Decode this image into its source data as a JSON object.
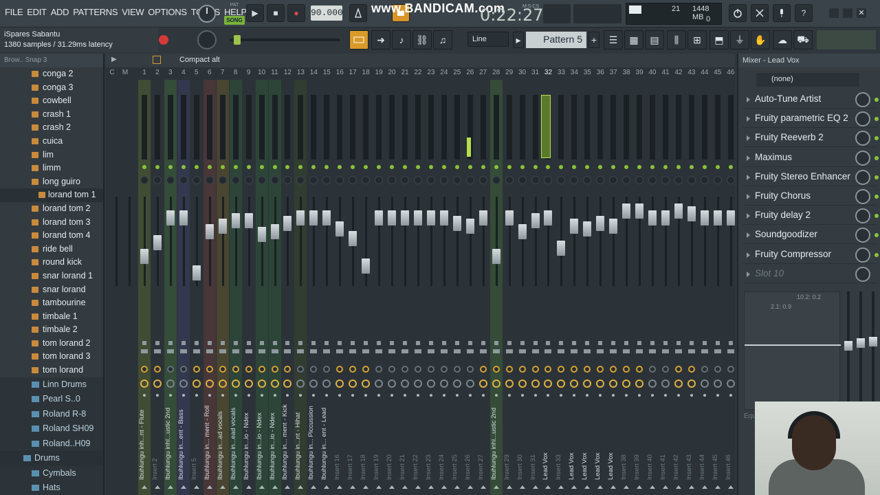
{
  "menu": [
    "FILE",
    "EDIT",
    "ADD",
    "PATTERNS",
    "VIEW",
    "OPTIONS",
    "TOOLS",
    "HELP"
  ],
  "transport": {
    "mode_small": "PAT",
    "mode": "SONG",
    "play": "▶",
    "stop": "■",
    "record": "●",
    "tempo": "90.000"
  },
  "watermark": "www.BANDICAM.com",
  "clock": {
    "time": "0:22:27",
    "label": "M:S:CS"
  },
  "cpu": {
    "v1": "21",
    "memory": "1448 MB",
    "v2": "0"
  },
  "hint": {
    "line1": "iSpares Sabantu",
    "line2": "1380 samples / 31.29ms latency"
  },
  "toolbar2": {
    "snap_mode": "Line",
    "pattern": "Pattern 5"
  },
  "browser": {
    "header": "Brow.. Snap 3",
    "items": [
      "conga 2",
      "conga 3",
      "cowbell",
      "crash 1",
      "crash 2",
      "cuica",
      "lim",
      "limm",
      "long guiro",
      "lorand tom 1",
      "lorand tom 2",
      "lorand tom 3",
      "lorand tom 4",
      "ride bell",
      "round kick",
      "snar lorand 1",
      "snar lorand",
      "tambourine",
      "timbale 1",
      "timbale 2",
      "tom lorand 2",
      "tom lorand 3",
      "tom lorand"
    ],
    "selected": "lorand tom 1",
    "folders": [
      "Linn Drums",
      "Pearl S..0 Kicks",
      "Roland R-8",
      "Roland SH09",
      "Roland..H09 (1)"
    ],
    "top_folder": "Drums",
    "sub_folders": [
      "Cymbals",
      "Hats"
    ]
  },
  "mixer": {
    "view": "Compact alt",
    "master_label": "C",
    "m_label": "M",
    "tracks": [
      {
        "n": "1",
        "name": "Ibuhlungu inh...nt - Flute",
        "color": "#5a6a32",
        "fader": 0.62,
        "ring": true
      },
      {
        "n": "2",
        "name": "Insert 2",
        "color": "",
        "fader": 0.72,
        "ring": true
      },
      {
        "n": "3",
        "name": "Ibuhlungu inhl...ustic 2nd",
        "color": "#3e6a3a",
        "fader": 0.9,
        "ring": false
      },
      {
        "n": "4",
        "name": "Ibuhlungu in...ent - Bass",
        "color": "#3c3e6a",
        "fader": 0.9,
        "ring": false
      },
      {
        "n": "5",
        "name": "Insert 5",
        "color": "",
        "fader": 0.5,
        "ring": true
      },
      {
        "n": "6",
        "name": "Ibuhlungu in... ment - Roll",
        "color": "#6a3a3a",
        "fader": 0.8,
        "ring": true
      },
      {
        "n": "7",
        "name": "Ibuhlungu in...ad vocals",
        "color": "#6a5a2a",
        "fader": 0.84,
        "ring": true
      },
      {
        "n": "8",
        "name": "Ibuhlungu in...ead vocals",
        "color": "#2f5a3a",
        "fader": 0.88,
        "ring": true
      },
      {
        "n": "9",
        "name": "Ibuhlungu in...io - Ndex",
        "color": "",
        "fader": 0.88,
        "ring": true
      },
      {
        "n": "10",
        "name": "Ibuhlungu in...io - Ndex",
        "color": "#2f5a3a",
        "fader": 0.78,
        "ring": true
      },
      {
        "n": "11",
        "name": "Ibuhlungu in...io - Ndex",
        "color": "#2f5a3a",
        "fader": 0.8,
        "ring": true
      },
      {
        "n": "12",
        "name": "Ibuhlungu in... ment - Kick",
        "color": "",
        "fader": 0.86,
        "ring": true
      },
      {
        "n": "13",
        "name": "Ibuhlungu in...nt - Hihat",
        "color": "#3a4a2a",
        "fader": 0.9,
        "ring": false
      },
      {
        "n": "14",
        "name": "Ibuhlungu in... Piccussion",
        "color": "",
        "fader": 0.9,
        "ring": false
      },
      {
        "n": "15",
        "name": "Ibuhlungu in... ent - Lead",
        "color": "",
        "fader": 0.9,
        "ring": false
      },
      {
        "n": "16",
        "name": "Insert 16",
        "color": "",
        "fader": 0.82,
        "ring": true
      },
      {
        "n": "17",
        "name": "Insert 17",
        "color": "",
        "fader": 0.75,
        "ring": true
      },
      {
        "n": "18",
        "name": "Insert 18",
        "color": "",
        "fader": 0.55,
        "ring": true
      },
      {
        "n": "19",
        "name": "Insert 19",
        "color": "",
        "fader": 0.9,
        "ring": false
      },
      {
        "n": "20",
        "name": "Insert 20",
        "color": "",
        "fader": 0.9,
        "ring": false
      },
      {
        "n": "21",
        "name": "Insert 21",
        "color": "",
        "fader": 0.9,
        "ring": false
      },
      {
        "n": "22",
        "name": "Insert 22",
        "color": "",
        "fader": 0.9,
        "ring": false
      },
      {
        "n": "23",
        "name": "Insert 23",
        "color": "",
        "fader": 0.9,
        "ring": false
      },
      {
        "n": "24",
        "name": "Insert 24",
        "color": "",
        "fader": 0.9,
        "ring": false
      },
      {
        "n": "25",
        "name": "Insert 25",
        "color": "",
        "fader": 0.86,
        "ring": false
      },
      {
        "n": "26",
        "name": "Insert 26",
        "color": "",
        "fader": 0.84,
        "ring": false
      },
      {
        "n": "27",
        "name": "Insert 27",
        "color": "",
        "fader": 0.9,
        "ring": true
      },
      {
        "n": "28",
        "name": "Ibuhlungu inhl...ustic 2nd",
        "color": "#3e6a3a",
        "fader": 0.62,
        "ring": true
      },
      {
        "n": "29",
        "name": "Insert 29",
        "color": "",
        "fader": 0.9,
        "ring": true
      },
      {
        "n": "30",
        "name": "Insert 30",
        "color": "",
        "fader": 0.8,
        "ring": true
      },
      {
        "n": "31",
        "name": "Insert 31",
        "color": "",
        "fader": 0.88,
        "ring": true
      },
      {
        "n": "32",
        "name": "Lead Vox",
        "color": "",
        "fader": 0.9,
        "ring": true
      },
      {
        "n": "33",
        "name": "Insert 33",
        "color": "",
        "fader": 0.68,
        "ring": true
      },
      {
        "n": "34",
        "name": "Lead Vox",
        "color": "",
        "fader": 0.84,
        "ring": true
      },
      {
        "n": "35",
        "name": "Lead Vox",
        "color": "",
        "fader": 0.82,
        "ring": true
      },
      {
        "n": "36",
        "name": "Lead Vox",
        "color": "",
        "fader": 0.86,
        "ring": true
      },
      {
        "n": "37",
        "name": "Lead Vox",
        "color": "",
        "fader": 0.84,
        "ring": true
      },
      {
        "n": "38",
        "name": "Insert 38",
        "color": "",
        "fader": 0.95,
        "ring": true
      },
      {
        "n": "39",
        "name": "Insert 39",
        "color": "",
        "fader": 0.95,
        "ring": true
      },
      {
        "n": "40",
        "name": "Insert 40",
        "color": "",
        "fader": 0.9,
        "ring": false
      },
      {
        "n": "41",
        "name": "Insert 41",
        "color": "",
        "fader": 0.9,
        "ring": false
      },
      {
        "n": "42",
        "name": "Insert 42",
        "color": "",
        "fader": 0.95,
        "ring": true
      },
      {
        "n": "43",
        "name": "Insert 43",
        "color": "",
        "fader": 0.93,
        "ring": true
      },
      {
        "n": "44",
        "name": "Insert 44",
        "color": "",
        "fader": 0.9,
        "ring": false
      },
      {
        "n": "45",
        "name": "Insert 45",
        "color": "",
        "fader": 0.9,
        "ring": false
      },
      {
        "n": "46",
        "name": "Insert 46",
        "color": "",
        "fader": 0.9,
        "ring": false
      }
    ]
  },
  "fx": {
    "title": "Mixer - Lead Vox",
    "input": "(none)",
    "slots": [
      "Auto-Tune Artist",
      "Fruity parametric EQ 2",
      "Fruity Reeverb 2",
      "Maximus",
      "Fruity Stereo Enhancer",
      "Fruity Chorus",
      "Fruity delay 2",
      "Soundgoodizer",
      "Fruity Compressor",
      "Slot 10"
    ],
    "eq_label1": "10.2: 0.2",
    "eq_label2": "2.1: 0.9",
    "eq_text": "Equ"
  },
  "colors": {
    "accent": "#a8d64a",
    "panel": "#343c42",
    "highlight": "#b6e049"
  }
}
